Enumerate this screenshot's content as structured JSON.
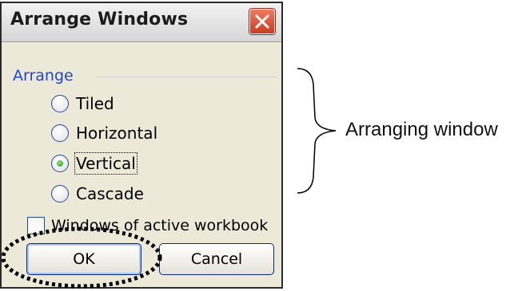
{
  "dialog": {
    "title": "Arrange Windows",
    "close_icon": "close-icon",
    "group_label": "Arrange",
    "options": [
      {
        "label": "Tiled",
        "selected": false
      },
      {
        "label": "Horizontal",
        "selected": false
      },
      {
        "label": "Vertical",
        "selected": true
      },
      {
        "label": "Cascade",
        "selected": false
      }
    ],
    "checkbox_label": "Windows of active workbook",
    "checkbox_checked": false,
    "ok_label": "OK",
    "cancel_label": "Cancel"
  },
  "annotation": {
    "label": "Arranging window"
  },
  "colors": {
    "dialog_bg": "#ece9d8",
    "group_label": "#2244cc",
    "close_button": "#d9533a",
    "radio_selected_dot": "#2b9a20"
  }
}
